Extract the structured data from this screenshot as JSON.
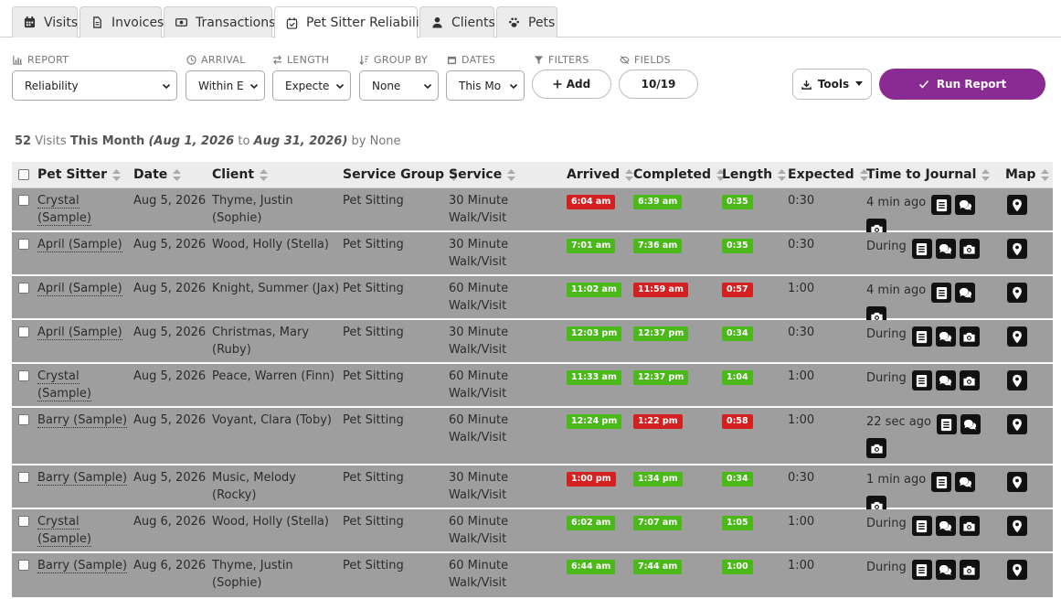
{
  "tabs": [
    {
      "label": "Visits",
      "icon": "calendar-icon"
    },
    {
      "label": "Invoices",
      "icon": "file-icon"
    },
    {
      "label": "Transactions",
      "icon": "money-icon"
    },
    {
      "label": "Pet Sitter Reliability",
      "icon": "calendar-check-icon",
      "active": true
    },
    {
      "label": "Clients",
      "icon": "user-icon"
    },
    {
      "label": "Pets",
      "icon": "paw-icon"
    }
  ],
  "controls": {
    "report": {
      "label": "REPORT",
      "value": "Reliability"
    },
    "arrival": {
      "label": "ARRIVAL",
      "value": "Within E"
    },
    "length": {
      "label": "LENGTH",
      "value": "Expecte"
    },
    "group_by": {
      "label": "GROUP BY",
      "value": "None"
    },
    "dates": {
      "label": "DATES",
      "value": "This Mo"
    },
    "filters": {
      "label": "FILTERS",
      "button": "Add"
    },
    "fields": {
      "label": "FIELDS",
      "value": "10/19"
    },
    "tools": "Tools",
    "run": "Run Report"
  },
  "summary": {
    "count": "52",
    "visits_word": "Visits",
    "period": "This Month",
    "range_start": "(Aug 1, 2026",
    "to_word": "to",
    "range_end": "Aug 31, 2026)",
    "by_word": "by None"
  },
  "columns": [
    "Pet Sitter",
    "Date",
    "Client",
    "Service Group",
    "Service",
    "Arrived",
    "Completed",
    "Length",
    "Expected",
    "Time to Journal",
    "Map"
  ],
  "colors": {
    "on_time": "#4bb81a",
    "late": "#d42020",
    "accent": "#8a2a93",
    "row_bg": "#9e9e9e"
  },
  "rows": [
    {
      "sitter": [
        "Crystal",
        "(Sample)"
      ],
      "date": "Aug 5, 2026",
      "client": [
        "Thyme, Justin",
        "(Sophie)"
      ],
      "group": "Pet Sitting",
      "service": [
        "30 Minute",
        "Walk/Visit"
      ],
      "arrived": "6:04 am",
      "arrived_status": "red",
      "completed": "6:39 am",
      "completed_status": "green",
      "length": "0:35",
      "length_status": "green",
      "expected": "0:30",
      "journal": "4 min ago"
    },
    {
      "sitter": [
        "April (Sample)"
      ],
      "date": "Aug 5, 2026",
      "client": [
        "Wood, Holly (Stella)"
      ],
      "group": "Pet Sitting",
      "service": [
        "30 Minute",
        "Walk/Visit"
      ],
      "arrived": "7:01 am",
      "arrived_status": "green",
      "completed": "7:36 am",
      "completed_status": "green",
      "length": "0:35",
      "length_status": "green",
      "expected": "0:30",
      "journal": "During"
    },
    {
      "sitter": [
        "April (Sample)"
      ],
      "date": "Aug 5, 2026",
      "client": [
        "Knight, Summer (Jax)"
      ],
      "group": "Pet Sitting",
      "service": [
        "60 Minute",
        "Walk/Visit"
      ],
      "arrived": "11:02 am",
      "arrived_status": "green",
      "completed": "11:59 am",
      "completed_status": "red",
      "length": "0:57",
      "length_status": "red",
      "expected": "1:00",
      "journal": "4 min ago"
    },
    {
      "sitter": [
        "April (Sample)"
      ],
      "date": "Aug 5, 2026",
      "client": [
        "Christmas, Mary",
        "(Ruby)"
      ],
      "group": "Pet Sitting",
      "service": [
        "30 Minute",
        "Walk/Visit"
      ],
      "arrived": "12:03 pm",
      "arrived_status": "green",
      "completed": "12:37 pm",
      "completed_status": "green",
      "length": "0:34",
      "length_status": "green",
      "expected": "0:30",
      "journal": "During"
    },
    {
      "sitter": [
        "Crystal",
        "(Sample)"
      ],
      "date": "Aug 5, 2026",
      "client": [
        "Peace, Warren (Finn)"
      ],
      "group": "Pet Sitting",
      "service": [
        "60 Minute",
        "Walk/Visit"
      ],
      "arrived": "11:33 am",
      "arrived_status": "green",
      "completed": "12:37 pm",
      "completed_status": "green",
      "length": "1:04",
      "length_status": "green",
      "expected": "1:00",
      "journal": "During"
    },
    {
      "sitter": [
        "Barry (Sample)"
      ],
      "date": "Aug 5, 2026",
      "client": [
        "Voyant, Clara (Toby)"
      ],
      "group": "Pet Sitting",
      "service": [
        "60 Minute",
        "Walk/Visit"
      ],
      "arrived": "12:24 pm",
      "arrived_status": "green",
      "completed": "1:22 pm",
      "completed_status": "red",
      "length": "0:58",
      "length_status": "red",
      "expected": "1:00",
      "journal": "22 sec ago"
    },
    {
      "sitter": [
        "Barry (Sample)"
      ],
      "date": "Aug 5, 2026",
      "client": [
        "Music, Melody (Rocky)"
      ],
      "group": "Pet Sitting",
      "service": [
        "30 Minute",
        "Walk/Visit"
      ],
      "arrived": "1:00 pm",
      "arrived_status": "red",
      "completed": "1:34 pm",
      "completed_status": "green",
      "length": "0:34",
      "length_status": "green",
      "expected": "0:30",
      "journal": "1 min ago"
    },
    {
      "sitter": [
        "Crystal",
        "(Sample)"
      ],
      "date": "Aug 6, 2026",
      "client": [
        "Wood, Holly (Stella)"
      ],
      "group": "Pet Sitting",
      "service": [
        "60 Minute",
        "Walk/Visit"
      ],
      "arrived": "6:02 am",
      "arrived_status": "green",
      "completed": "7:07 am",
      "completed_status": "green",
      "length": "1:05",
      "length_status": "green",
      "expected": "1:00",
      "journal": "During"
    },
    {
      "sitter": [
        "Barry (Sample)"
      ],
      "date": "Aug 6, 2026",
      "client": [
        "Thyme, Justin",
        "(Sophie)"
      ],
      "group": "Pet Sitting",
      "service": [
        "60 Minute",
        "Walk/Visit"
      ],
      "arrived": "6:44 am",
      "arrived_status": "green",
      "completed": "7:44 am",
      "completed_status": "green",
      "length": "1:00",
      "length_status": "green",
      "expected": "1:00",
      "journal": "During"
    }
  ]
}
